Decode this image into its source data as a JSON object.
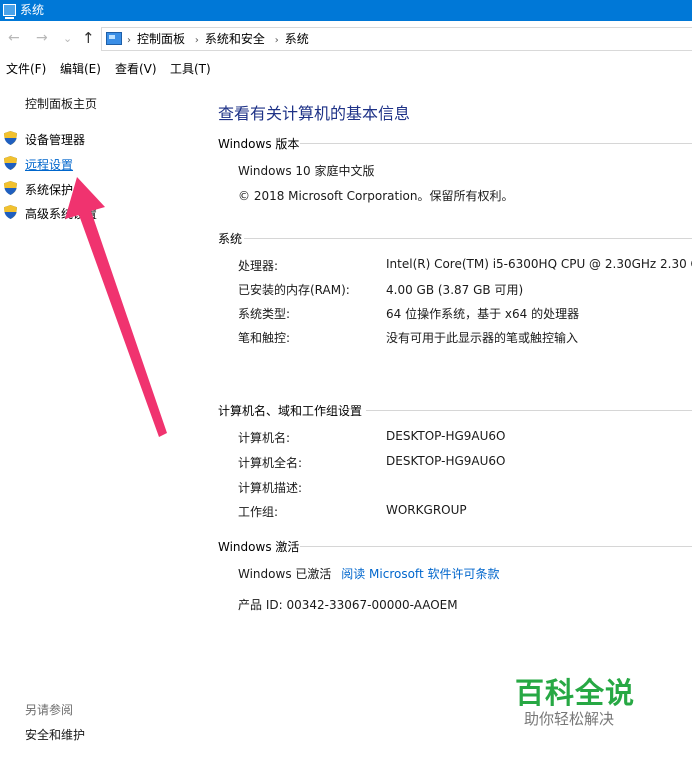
{
  "window": {
    "title": "系统"
  },
  "nav": {
    "back": "←",
    "forward": "→",
    "recent": "⌄",
    "up": "↑"
  },
  "address": {
    "sep": "›",
    "crumbs": [
      "控制面板",
      "系统和安全",
      "系统"
    ]
  },
  "menu": {
    "file": "文件(F)",
    "edit": "编辑(E)",
    "view": "查看(V)",
    "tools": "工具(T)"
  },
  "sidebar": {
    "home": "控制面板主页",
    "items": [
      {
        "label": "设备管理器",
        "icon": "shield-icon"
      },
      {
        "label": "远程设置",
        "icon": "shield-icon"
      },
      {
        "label": "系统保护",
        "icon": "shield-icon"
      },
      {
        "label": "高级系统设置",
        "icon": "shield-icon"
      }
    ],
    "see_also": "另请参阅",
    "security_maintenance": "安全和维护"
  },
  "main": {
    "title": "查看有关计算机的基本信息",
    "edition": {
      "header": "Windows 版本",
      "name": "Windows 10 家庭中文版",
      "copyright": "© 2018 Microsoft Corporation。保留所有权利。"
    },
    "system": {
      "header": "系统",
      "processor_label": "处理器:",
      "processor_value": "Intel(R) Core(TM) i5-6300HQ CPU @ 2.30GHz   2.30 G",
      "ram_label": "已安装的内存(RAM):",
      "ram_value": "4.00 GB (3.87 GB 可用)",
      "type_label": "系统类型:",
      "type_value": "64 位操作系统，基于 x64 的处理器",
      "pen_label": "笔和触控:",
      "pen_value": "没有可用于此显示器的笔或触控输入"
    },
    "computer": {
      "header": "计算机名、域和工作组设置",
      "name_label": "计算机名:",
      "name_value": "DESKTOP-HG9AU6O",
      "fullname_label": "计算机全名:",
      "fullname_value": "DESKTOP-HG9AU6O",
      "desc_label": "计算机描述:",
      "workgroup_label": "工作组:",
      "workgroup_value": "WORKGROUP"
    },
    "activation": {
      "header": "Windows 激活",
      "status": "Windows 已激活",
      "license_link": "阅读 Microsoft 软件许可条款",
      "product_id": "产品 ID: 00342-33067-00000-AAOEM"
    }
  },
  "watermark": {
    "title": "百科全说",
    "subtitle": "助你轻松解决"
  },
  "colors": {
    "titlebar": "#0078d7",
    "link": "#0066cc",
    "page_title": "#1e3287",
    "arrow": "#f0336f",
    "watermark": "#27a844"
  }
}
